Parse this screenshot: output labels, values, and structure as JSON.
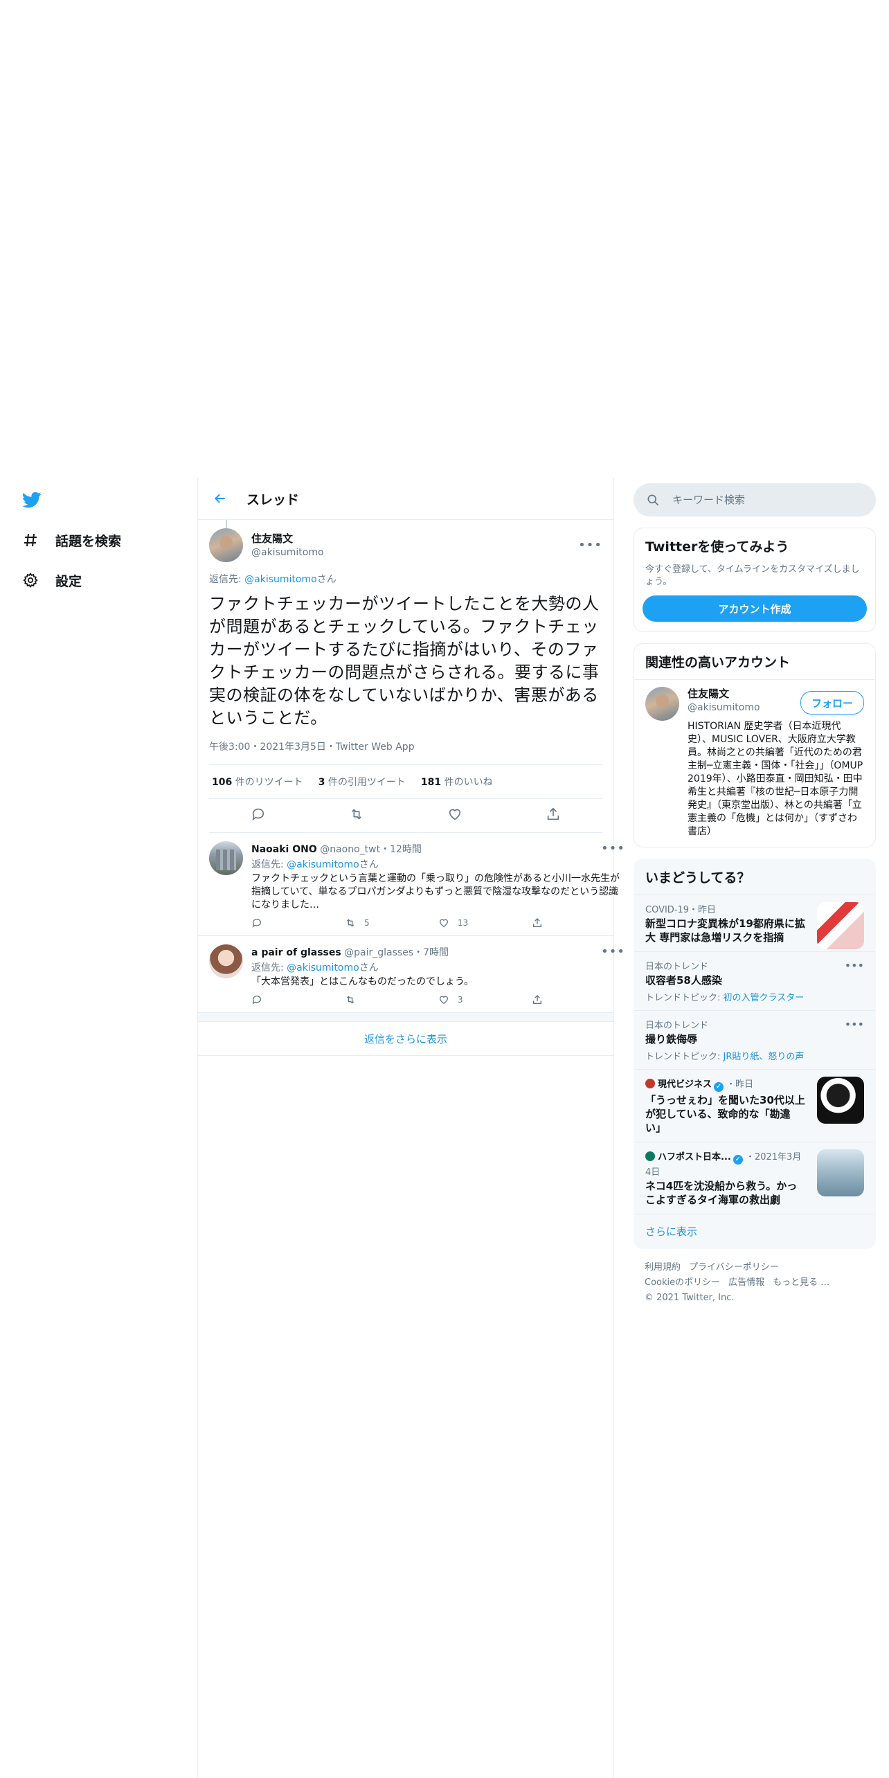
{
  "nav": {
    "items": [
      {
        "label": "話題を検索",
        "icon": "hash-icon"
      },
      {
        "label": "設定",
        "icon": "gear-icon"
      }
    ]
  },
  "header": {
    "title": "スレッド"
  },
  "tweet": {
    "author_name": "住友陽文",
    "author_handle": "@akisumitomo",
    "reply_to_prefix": "返信先: ",
    "reply_to_handle": "@akisumitomo",
    "reply_to_suffix": "さん",
    "text": "ファクトチェッカーがツイートしたことを大勢の人が問題があるとチェックしている。ファクトチェッカーがツイートするたびに指摘がはいり、そのファクトチェッカーの問題点がさらされる。要するに事実の検証の体をなしていないばかりか、害悪があるということだ。",
    "meta": "午後3:00・2021年3月5日・Twitter Web App",
    "retweets": "106",
    "retweets_label": "件のリツイート",
    "quotes": "3",
    "quotes_label": "件の引用ツイート",
    "likes": "181",
    "likes_label": "件のいいね"
  },
  "replies": [
    {
      "name": "Naoaki ONO",
      "handle": "@naono_twt・12時間",
      "reply_to_prefix": "返信先: ",
      "reply_to_handle": "@akisumitomo",
      "reply_to_suffix": "さん",
      "text": "ファクトチェックという言葉と運動の「乗っ取り」の危険性があると小川一水先生が指摘していて、単なるプロパガンダよりもずっと悪質で陰湿な攻撃なのだという認識になりました…",
      "reply_count": "",
      "retweet_count": "5",
      "like_count": "13"
    },
    {
      "name": "a pair of glasses",
      "handle": "@pair_glasses・7時間",
      "reply_to_prefix": "返信先: ",
      "reply_to_handle": "@akisumitomo",
      "reply_to_suffix": "さん",
      "text": "「大本営発表」とはこんなものだったのでしょう。",
      "reply_count": "",
      "retweet_count": "",
      "like_count": "3"
    }
  ],
  "show_more_replies": "返信をさらに表示",
  "search": {
    "placeholder": "キーワード検索"
  },
  "signup": {
    "title": "Twitterを使ってみよう",
    "desc": "今すぐ登録して、タイムラインをカスタマイズしましょう。",
    "button": "アカウント作成"
  },
  "related": {
    "title": "関連性の高いアカウント",
    "name": "住友陽文",
    "handle": "@akisumitomo",
    "follow": "フォロー",
    "bio": "HISTORIAN 歴史学者（日本近現代史）、MUSIC LOVER、大阪府立大学教員。林尚之との共編著「近代のための君主制─立憲主義・国体・「社会」」（OMUP 2019年）、小路田泰直・岡田知弘・田中希生と共編著『核の世紀─日本原子力開発史』（東京堂出版）、林との共編著「立憲主義の「危機」とは何か」（すずさわ書店）"
  },
  "trends": {
    "title": "いまどうしてる？",
    "items": [
      {
        "context": "COVID-19・昨日",
        "title": "新型コロナ変異株が19都府県に拡大 専門家は急増リスクを指摘",
        "topic_label": "",
        "topic_links": ""
      },
      {
        "context": "日本のトレンド",
        "title": "収容者58人感染",
        "topic_label": "トレンドトピック: ",
        "topic_links": "初の入管クラスター"
      },
      {
        "context": "日本のトレンド",
        "title": "撮り鉄侮辱",
        "topic_label": "トレンドトピック: ",
        "topic_links": "JR貼り紙、怒りの声"
      },
      {
        "source": "現代ビジネス",
        "context": "・昨日",
        "title": "「うっせぇわ」を聞いた30代以上が犯している、致命的な「勘違い」",
        "topic_label": "",
        "topic_links": ""
      },
      {
        "source": "ハフポスト日本...",
        "context": "・2021年3月4日",
        "title": "ネコ4匹を沈没船から救う。かっこよすぎるタイ海軍の救出劇",
        "topic_label": "",
        "topic_links": ""
      }
    ],
    "show_more": "さらに表示"
  },
  "footer": {
    "links": [
      "利用規約",
      "プライバシーポリシー",
      "Cookieのポリシー",
      "広告情報",
      "もっと見る …"
    ],
    "copyright": "© 2021 Twitter, Inc."
  },
  "colors": {
    "accent": "#1da1f2",
    "link": "#1b95e0",
    "muted": "#657786",
    "border": "#e6ecf0"
  }
}
